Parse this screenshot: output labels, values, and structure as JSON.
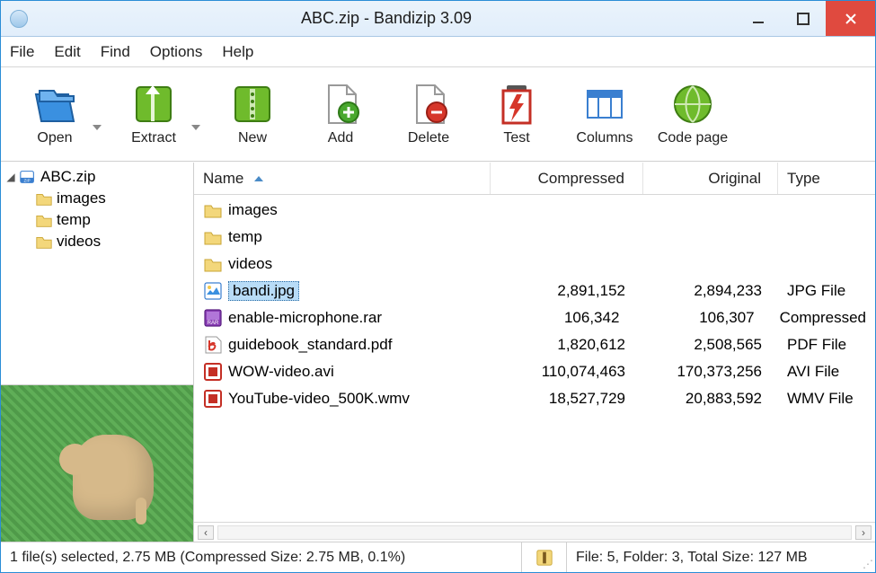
{
  "title": "ABC.zip - Bandizip 3.09",
  "menu": {
    "file": "File",
    "edit": "Edit",
    "find": "Find",
    "options": "Options",
    "help": "Help"
  },
  "toolbar": {
    "open": "Open",
    "extract": "Extract",
    "new": "New",
    "add": "Add",
    "delete": "Delete",
    "test": "Test",
    "columns": "Columns",
    "codepage": "Code page"
  },
  "tree": {
    "root": "ABC.zip",
    "children": [
      {
        "label": "images"
      },
      {
        "label": "temp"
      },
      {
        "label": "videos"
      }
    ]
  },
  "columns": {
    "name": "Name",
    "compressed": "Compressed",
    "original": "Original",
    "type": "Type"
  },
  "rows": [
    {
      "kind": "folder",
      "name": "images",
      "compressed": "",
      "original": "",
      "type": ""
    },
    {
      "kind": "folder",
      "name": "temp",
      "compressed": "",
      "original": "",
      "type": ""
    },
    {
      "kind": "folder",
      "name": "videos",
      "compressed": "",
      "original": "",
      "type": ""
    },
    {
      "kind": "jpg",
      "name": "bandi.jpg",
      "compressed": "2,891,152",
      "original": "2,894,233",
      "type": "JPG File",
      "selected": true
    },
    {
      "kind": "rar",
      "name": "enable-microphone.rar",
      "compressed": "106,342",
      "original": "106,307",
      "type": "Compressed"
    },
    {
      "kind": "pdf",
      "name": "guidebook_standard.pdf",
      "compressed": "1,820,612",
      "original": "2,508,565",
      "type": "PDF File"
    },
    {
      "kind": "avi",
      "name": "WOW-video.avi",
      "compressed": "110,074,463",
      "original": "170,373,256",
      "type": "AVI File"
    },
    {
      "kind": "wmv",
      "name": "YouTube-video_500K.wmv",
      "compressed": "18,527,729",
      "original": "20,883,592",
      "type": "WMV File"
    }
  ],
  "status": {
    "left": "1 file(s) selected, 2.75 MB (Compressed Size: 2.75 MB, 0.1%)",
    "right": "File: 5, Folder: 3, Total Size: 127 MB"
  }
}
